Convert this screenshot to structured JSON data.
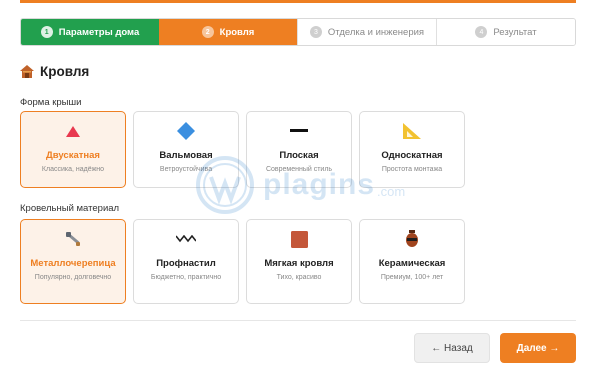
{
  "colors": {
    "accent": "#ee7f22",
    "done": "#22a04e"
  },
  "steps": [
    {
      "num": "1",
      "label": "Параметры дома",
      "state": "done"
    },
    {
      "num": "2",
      "label": "Кровля",
      "state": "active"
    },
    {
      "num": "3",
      "label": "Отделка и инженерия",
      "state": "todo"
    },
    {
      "num": "4",
      "label": "Результат",
      "state": "todo"
    }
  ],
  "section": {
    "icon": "house-icon",
    "title": "Кровля"
  },
  "roof_shape": {
    "label": "Форма крыши",
    "options": [
      {
        "title": "Двускатная",
        "desc": "Классика, надёжно",
        "icon": "triangle-icon",
        "selected": true
      },
      {
        "title": "Вальмовая",
        "desc": "Ветроустойчива",
        "icon": "diamond-icon",
        "selected": false
      },
      {
        "title": "Плоская",
        "desc": "Современный стиль",
        "icon": "flat-line-icon",
        "selected": false
      },
      {
        "title": "Односкатная",
        "desc": "Простота монтажа",
        "icon": "set-square-icon",
        "selected": false
      }
    ]
  },
  "roof_material": {
    "label": "Кровельный материал",
    "options": [
      {
        "title": "Металлочерепица",
        "desc": "Популярно, долговечно",
        "icon": "tools-icon",
        "selected": true
      },
      {
        "title": "Профнастил",
        "desc": "Бюджетно, практично",
        "icon": "wave-icon",
        "selected": false
      },
      {
        "title": "Мягкая кровля",
        "desc": "Тихо, красиво",
        "icon": "brick-square-icon",
        "selected": false
      },
      {
        "title": "Керамическая",
        "desc": "Премиум, 100+ лет",
        "icon": "amphora-icon",
        "selected": false
      }
    ]
  },
  "nav": {
    "back": "← Назад",
    "next": "Далее →"
  },
  "watermark": {
    "text": "plagins",
    "suffix": ".com"
  }
}
